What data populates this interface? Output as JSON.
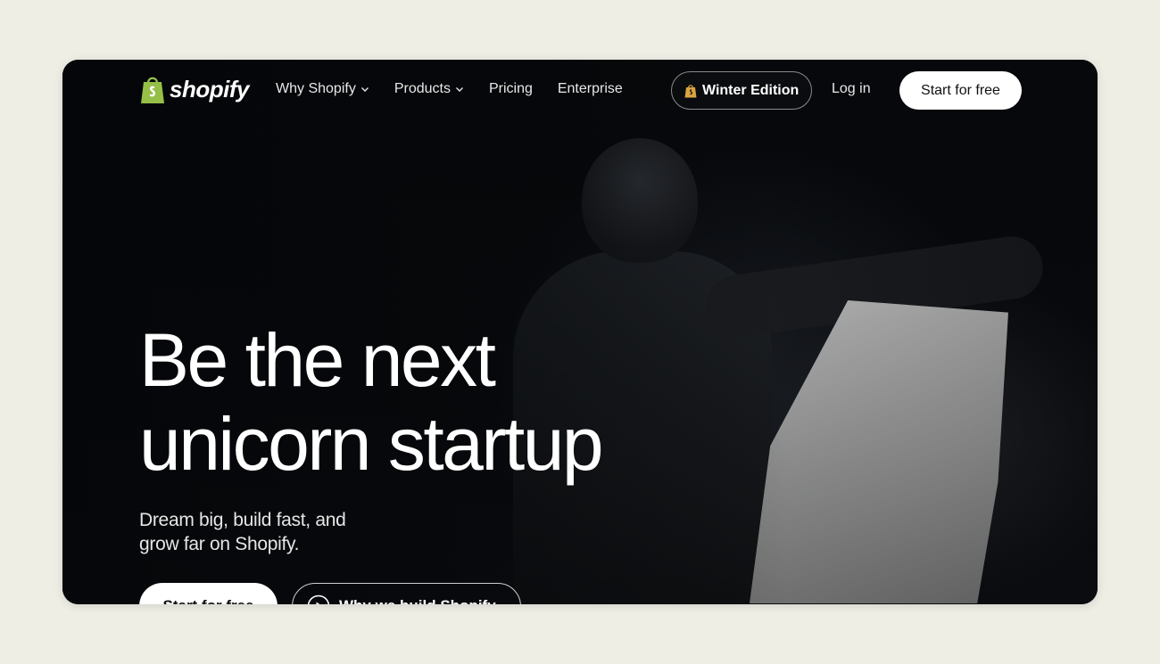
{
  "brand": {
    "name": "shopify",
    "accent": "#95bf47"
  },
  "nav": {
    "links": [
      {
        "label": "Why Shopify",
        "dropdown": true
      },
      {
        "label": "Products",
        "dropdown": true
      },
      {
        "label": "Pricing",
        "dropdown": false
      },
      {
        "label": "Enterprise",
        "dropdown": false
      }
    ],
    "winter_label": "Winter Edition",
    "login_label": "Log in",
    "start_label": "Start for free"
  },
  "hero": {
    "headline_line1": "Be the next",
    "headline_line2": "unicorn startup",
    "subhead": "Dream big, build fast, and grow far on Shopify.",
    "cta_primary": "Start for free",
    "cta_secondary": "Why we build Shopify"
  },
  "colors": {
    "page_bg": "#eeeee5",
    "hero_bg": "#05070a",
    "text": "#ffffff"
  }
}
